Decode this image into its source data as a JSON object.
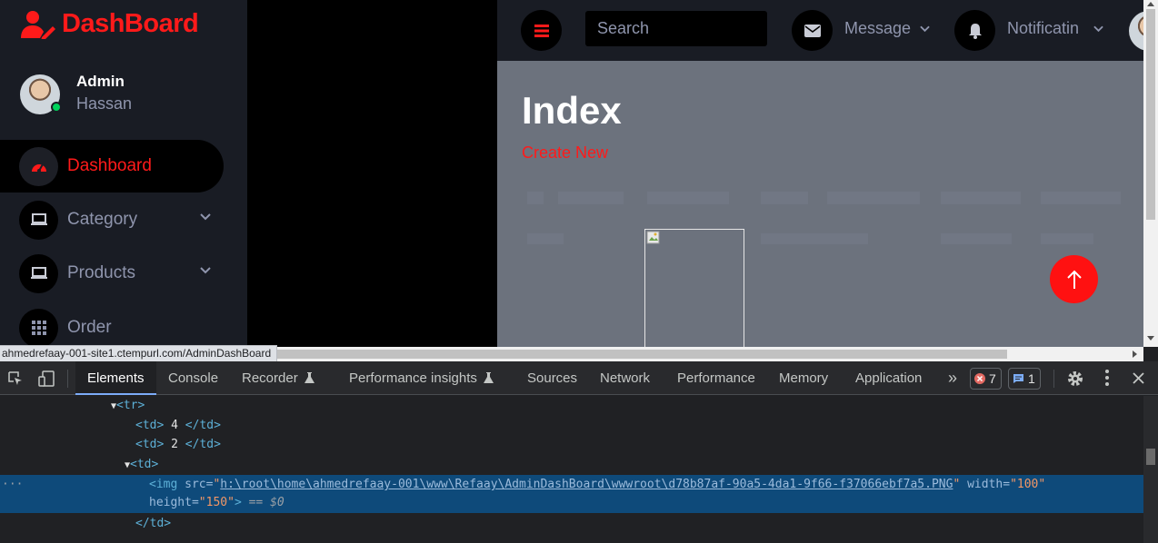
{
  "sidebar": {
    "brand": "DashBoard",
    "profile": {
      "name": "Admin",
      "subtitle": "Hassan"
    },
    "items": [
      {
        "label": "Dashboard",
        "icon": "speedometer-icon",
        "active": true
      },
      {
        "label": "Category",
        "icon": "laptop-icon"
      },
      {
        "label": "Products",
        "icon": "laptop-icon"
      },
      {
        "label": "Order",
        "icon": "grid-icon"
      }
    ]
  },
  "header": {
    "search_placeholder": "Search",
    "message_label": "Message",
    "notification_label": "Notificatin"
  },
  "content": {
    "title": "Index",
    "create_link": "Create New"
  },
  "status_bar": {
    "url": "ahmedrefaay-001-site1.ctempurl.com/AdminDashBoard"
  },
  "devtools": {
    "tabs": [
      "Elements",
      "Console",
      "Recorder",
      "Performance insights",
      "Sources",
      "Network",
      "Performance",
      "Memory",
      "Application"
    ],
    "more": "»",
    "error_count": "7",
    "message_count": "1",
    "code": {
      "tr_open": "<tr>",
      "td1_value": " 4 ",
      "td2_value": " 2 ",
      "td_open": "<td>",
      "img_src": "h:\\root\\home\\ahmedrefaay-001\\www\\Refaay\\AdminDashBoard\\wwwroot\\d78b87af-90a5-4da1-9f66-f37066ebf7a5.PNG",
      "img_width": "\"100\"",
      "img_height": "\"150\"",
      "selected_marker": "== $0",
      "td_close": "</td>"
    }
  },
  "colors": {
    "accent": "#ff1a1a",
    "sidebar_bg": "#191c24",
    "content_bg": "#6c727d",
    "devtools_selection": "#0e4a7a"
  }
}
